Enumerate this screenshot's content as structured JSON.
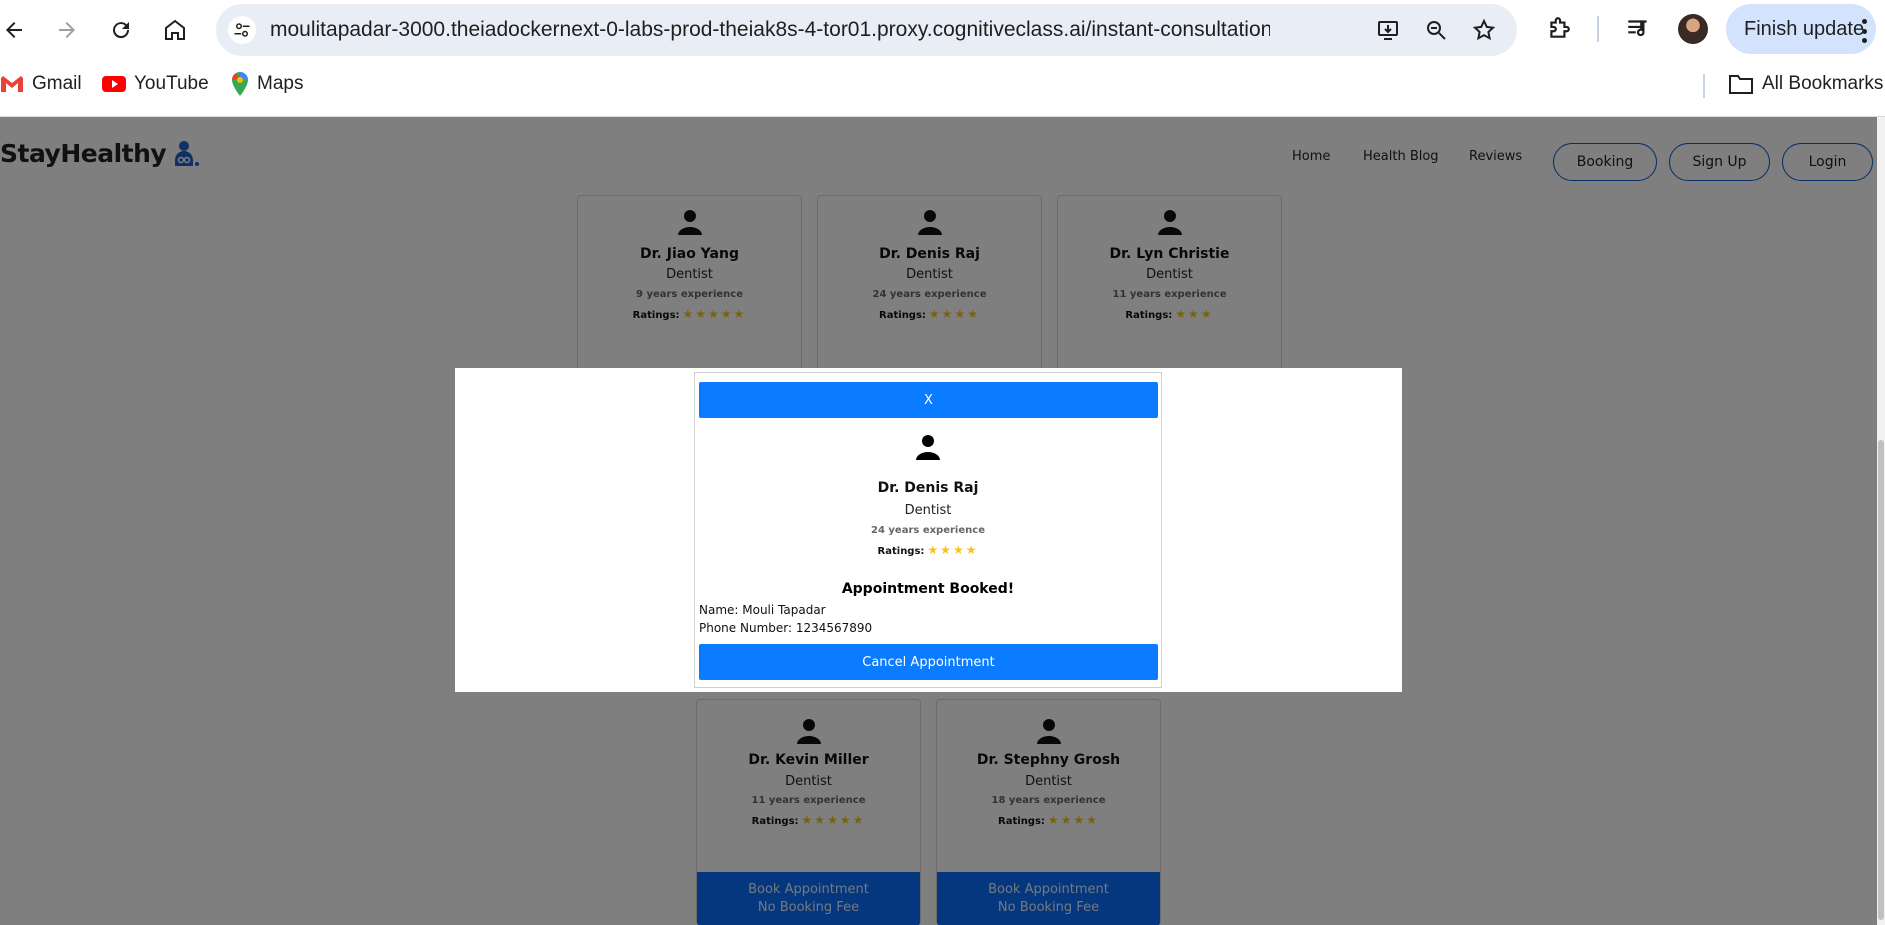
{
  "browser": {
    "url": "moulitapadar-3000.theiadockernext-0-labs-prod-theiak8s-4-tor01.proxy.cognitiveclass.ai/instant-consultation?spec...",
    "finish_update": "Finish update",
    "bookmarks": [
      {
        "label": "Gmail",
        "icon": "gmail-icon"
      },
      {
        "label": "YouTube",
        "icon": "youtube-icon"
      },
      {
        "label": "Maps",
        "icon": "maps-icon"
      }
    ],
    "all_bookmarks": "All Bookmarks"
  },
  "site": {
    "logo": "StayHealthy",
    "nav": [
      "Home",
      "Health Blog",
      "Reviews"
    ],
    "buttons": [
      "Booking",
      "Sign Up",
      "Login"
    ]
  },
  "cards_top": [
    {
      "name": "Dr. Jiao Yang",
      "speciality": "Dentist",
      "experience": "9 years experience",
      "ratings_label": "Ratings:",
      "stars": "★★★★★",
      "bar_color": "#0b6efd"
    },
    {
      "name": "Dr. Denis Raj",
      "speciality": "Dentist",
      "experience": "24 years experience",
      "ratings_label": "Ratings:",
      "stars": "★★★★",
      "bar_color": "#e0201b"
    },
    {
      "name": "Dr. Lyn Christie",
      "speciality": "Dentist",
      "experience": "11 years experience",
      "ratings_label": "Ratings:",
      "stars": "★★★",
      "bar_color": "#0b6efd"
    }
  ],
  "cards_bottom": [
    {
      "name": "Dr. Kevin Miller",
      "speciality": "Dentist",
      "experience": "11 years experience",
      "ratings_label": "Ratings:",
      "stars": "★★★★★",
      "book_label": "Book Appointment",
      "fee_label": "No Booking Fee"
    },
    {
      "name": "Dr. Stephny Grosh",
      "speciality": "Dentist",
      "experience": "18 years experience",
      "ratings_label": "Ratings:",
      "stars": "★★★★",
      "book_label": "Book Appointment",
      "fee_label": "No Booking Fee"
    }
  ],
  "modal": {
    "close_label": "X",
    "doctor_name": "Dr. Denis Raj",
    "speciality": "Dentist",
    "experience": "24 years experience",
    "ratings_label": "Ratings:",
    "stars": "★★★★",
    "title": "Appointment Booked!",
    "name_line": "Name: Mouli Tapadar",
    "phone_line": "Phone Number: 1234567890",
    "cancel_label": "Cancel Appointment"
  },
  "colors": {
    "primary": "#0b7bff",
    "star": "#f5c518",
    "danger": "#e0201b",
    "overlay": "rgba(0,0,0,0.5)"
  }
}
